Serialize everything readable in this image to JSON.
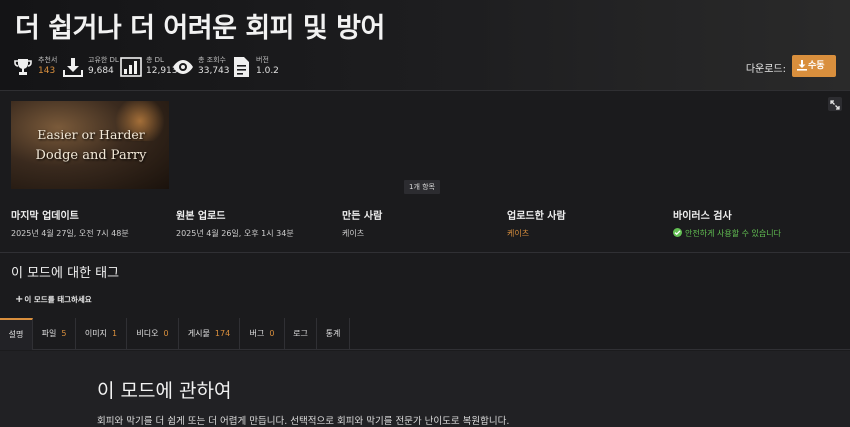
{
  "page": {
    "title": "더 쉽거나 더 어려운 회피 및 방어"
  },
  "stats": [
    {
      "label": "추천서",
      "value": "143",
      "icon": "trophy-icon",
      "highlight": true
    },
    {
      "label": "고유한 DL",
      "value": "9,684",
      "icon": "download-icon",
      "highlight": false
    },
    {
      "label": "총 DL",
      "value": "12,913",
      "icon": "bar-chart-icon",
      "highlight": false
    },
    {
      "label": "총 조회수",
      "value": "33,743",
      "icon": "eye-icon",
      "highlight": false
    },
    {
      "label": "버전",
      "value": "1.0.2",
      "icon": "document-icon",
      "highlight": false
    }
  ],
  "download": {
    "label": "다운로드:",
    "button": "수동"
  },
  "gallery": {
    "thumb_line1": "Easier or Harder",
    "thumb_line2": "Dodge and Parry",
    "count": "1개 항목"
  },
  "meta": [
    {
      "heading": "마지막 업데이트",
      "value": "2025년 4월 27일,  오전 7시 48분"
    },
    {
      "heading": "원본 업로드",
      "value": "2025년 4월 26일,  오후 1시 34분"
    },
    {
      "heading": "만든 사람",
      "value": "케이츠"
    },
    {
      "heading": "업로드한 사람",
      "value": "케이츠"
    },
    {
      "heading": "바이러스 검사",
      "value": "안전하게 사용할 수 있습니다"
    }
  ],
  "tags": {
    "title": "이 모드에 대한 태그",
    "add_button": "이 모드를 태그하세요"
  },
  "tabs": [
    {
      "label": "설명",
      "count": ""
    },
    {
      "label": "파일",
      "count": "5"
    },
    {
      "label": "이미지",
      "count": "1"
    },
    {
      "label": "비디오",
      "count": "0"
    },
    {
      "label": "게시물",
      "count": "174"
    },
    {
      "label": "버그",
      "count": "0"
    },
    {
      "label": "로그",
      "count": ""
    },
    {
      "label": "통계",
      "count": ""
    }
  ],
  "about": {
    "title": "이 모드에 관하여",
    "text": "회피와 막기를 더 쉽게 또는 더 어렵게 만듭니다. 선택적으로 회피와 막기를 전문가 난이도로 복원합니다."
  },
  "colors": {
    "accent": "#d98f3d",
    "safe": "#63c053",
    "background": "#1b1b1d"
  }
}
